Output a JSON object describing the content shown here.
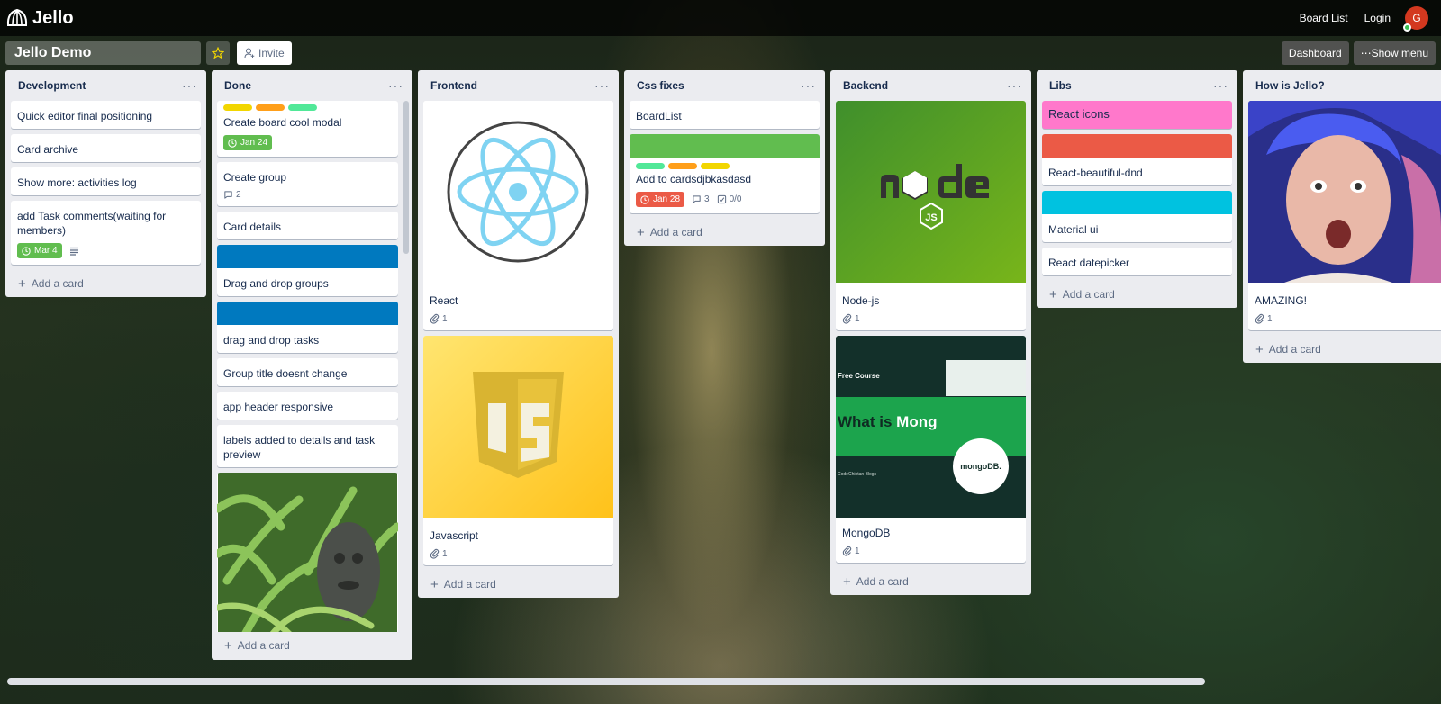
{
  "app": {
    "name": "Jello"
  },
  "nav": {
    "board_list": "Board List",
    "login": "Login",
    "avatar_initial": "G"
  },
  "board": {
    "title": "Jello Demo",
    "invite": "Invite",
    "dashboard": "Dashboard",
    "show_menu": "⋯Show menu"
  },
  "menu_glyph": "···",
  "add_card": "Add a card",
  "colors": {
    "green": "#61bd4f",
    "yellow": "#f2d600",
    "orange": "#ff9f1a",
    "red": "#eb5a46",
    "blue": "#0079bf",
    "pink": "#ff78cb",
    "sky": "#00c2e0",
    "lime": "#51e898"
  },
  "lists": [
    {
      "title": "Development",
      "cards": [
        {
          "title": "Quick editor final positioning"
        },
        {
          "title": "Card archive"
        },
        {
          "title": "Show more: activities log"
        },
        {
          "title": "add Task comments(waiting for members)",
          "due": "Mar 4",
          "has_description": true
        }
      ]
    },
    {
      "title": "Done",
      "cards": [
        {
          "title": "Create board cool modal",
          "labels": [
            "yellow",
            "orange",
            "lime"
          ],
          "due": "Jan 24"
        },
        {
          "title": "Create group",
          "comments": "2"
        },
        {
          "title": "Card details"
        },
        {
          "title": "Drag and drop groups",
          "cover_color": "blue"
        },
        {
          "title": "drag and drop tasks",
          "cover_color": "blue"
        },
        {
          "title": "Group title doesnt change"
        },
        {
          "title": "app header responsive"
        },
        {
          "title": "labels added to details and task preview"
        },
        {
          "title": "",
          "cover_image": "statue-in-plants-image"
        }
      ]
    },
    {
      "title": "Frontend",
      "cards": [
        {
          "title": "React",
          "cover_image": "react-logo-image",
          "attachments": "1"
        },
        {
          "title": "Javascript",
          "cover_image": "js-logo-image",
          "attachments": "1"
        }
      ]
    },
    {
      "title": "Css fixes",
      "cards": [
        {
          "title": "BoardList"
        },
        {
          "title": "Add to cardsdjbkasdasd",
          "cover_color": "green",
          "labels": [
            "lime",
            "orange",
            "yellow"
          ],
          "due": "Jan 28",
          "comments": "3",
          "checklist": "0/0"
        }
      ]
    },
    {
      "title": "Backend",
      "cards": [
        {
          "title": "Node-js",
          "cover_image": "nodejs-logo-image",
          "attachments": "1"
        },
        {
          "title": "MongoDB",
          "cover_image": "mongodb-banner-image",
          "attachments": "1",
          "cover_text": {
            "free_course": "Free Course",
            "headline_a": "What is ",
            "headline_b": "Mong",
            "blog": "CodeChintan Blogs",
            "brand": "mongoDB."
          }
        }
      ]
    },
    {
      "title": "Libs",
      "cards": [
        {
          "title": "React icons",
          "cover_color": "pink"
        },
        {
          "title": "React-beautiful-dnd",
          "cover_color": "red"
        },
        {
          "title": "Material ui",
          "cover_color": "sky"
        },
        {
          "title": "React datepicker"
        }
      ]
    },
    {
      "title": "How is Jello?",
      "cards": [
        {
          "title": "AMAZING!",
          "cover_image": "surprised-person-image",
          "attachments": "1"
        }
      ]
    }
  ]
}
